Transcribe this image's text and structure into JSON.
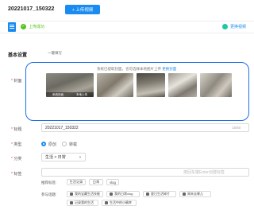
{
  "header": {
    "title": "20221017_150322",
    "new_button_label": "+ 上传视频"
  },
  "status": {
    "ok_text": "上传成功",
    "right_text": "更换视频"
  },
  "section": {
    "title": "基本设置",
    "subtitle": "一键填写"
  },
  "cover": {
    "label": "封面",
    "hint": "系统已提取封面，也可选择本地图片上传 ",
    "hint_link": "更换封面",
    "thumb_tags": [
      "系统封面",
      "本地上传"
    ]
  },
  "title_field": {
    "label": "标题",
    "value": "20221017_150322",
    "counter": "15/60"
  },
  "type_field": {
    "label": "类型",
    "options": [
      "原创",
      "转载"
    ]
  },
  "category_field": {
    "label": "分类",
    "value": "生活 > 日常"
  },
  "tags_field": {
    "label": "标签",
    "placeholder": "按回车键Enter创建标签",
    "recommend_label": "推荐标签:",
    "recommend_tags": [
      "生活记录",
      "日常",
      "vlog"
    ],
    "topic_label": "参与话题:",
    "topics": [
      "我的宝藏生活技能",
      "我的日常vlog",
      "夏日生活碎片",
      "周末去哪儿",
      "记录我的生活",
      "生活中的小确幸"
    ]
  }
}
